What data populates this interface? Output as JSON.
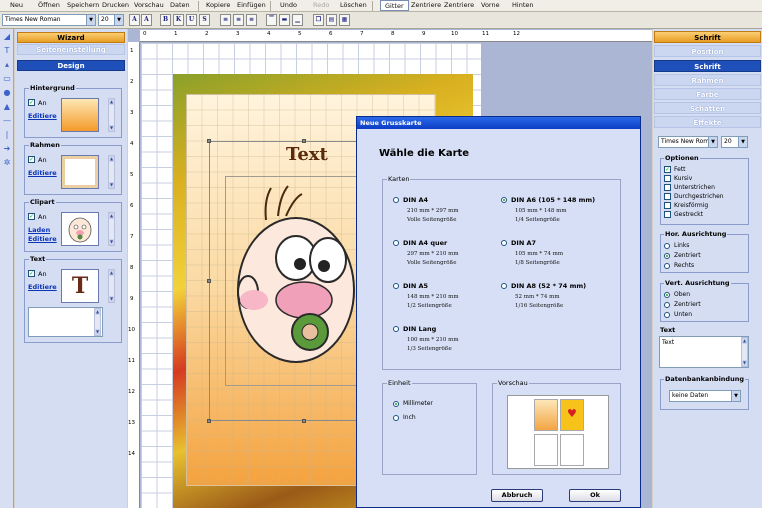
{
  "menu": {
    "items": [
      "Neu",
      "Öffnen",
      "Speichern",
      "Drucken",
      "Vorschau",
      "Daten",
      "Kopiere",
      "Einfügen",
      "Undo",
      "Redo",
      "Löschen",
      "Gitter",
      "Zentriere",
      "Zentriere",
      "Vorne",
      "Hinten"
    ]
  },
  "toolbar": {
    "font_value": "Times New Roman",
    "size_value": "20"
  },
  "left_panel": {
    "tab_wizard": "Wizard",
    "tab_page_setup": "Seiteneinstellung",
    "tab_design": "Design",
    "background": {
      "title": "Hintergrund",
      "on_label": "An",
      "edit_link": "Editiere"
    },
    "frame": {
      "title": "Rahmen",
      "on_label": "An",
      "edit_link": "Editiere"
    },
    "clipart": {
      "title": "Clipart",
      "on_label": "An",
      "load_link": "Laden",
      "edit_link": "Editiere"
    },
    "text": {
      "title": "Text",
      "on_label": "An",
      "edit_link": "Editiere"
    }
  },
  "rulers": {
    "top": [
      "0",
      "1",
      "2",
      "3",
      "4",
      "5",
      "6",
      "7",
      "8",
      "9",
      "10",
      "11",
      "12"
    ],
    "left": [
      "1",
      "2",
      "3",
      "4",
      "5",
      "6",
      "7",
      "8",
      "9",
      "10",
      "11",
      "12",
      "13",
      "14"
    ]
  },
  "canvas": {
    "card_text": "Text"
  },
  "right_panel": {
    "tabs": [
      "Schrift",
      "Position",
      "Schrift",
      "Rahmen",
      "Farbe",
      "Schatten",
      "Effekte"
    ],
    "font_value": "Times New Rom",
    "size_value": "20",
    "options": {
      "title": "Optionen",
      "items": [
        {
          "label": "Fett",
          "checked": true
        },
        {
          "label": "Kursiv",
          "checked": false
        },
        {
          "label": "Unterstrichen",
          "checked": false
        },
        {
          "label": "Durchgestrichen",
          "checked": false
        },
        {
          "label": "Kreisförmig",
          "checked": false
        },
        {
          "label": "Gestreckt",
          "checked": false
        }
      ]
    },
    "h_align": {
      "title": "Hor. Ausrichtung",
      "items": [
        {
          "label": "Links",
          "selected": false
        },
        {
          "label": "Zentriert",
          "selected": true
        },
        {
          "label": "Rechts",
          "selected": false
        }
      ]
    },
    "v_align": {
      "title": "Vert. Ausrichtung",
      "items": [
        {
          "label": "Oben",
          "selected": true
        },
        {
          "label": "Zentriert",
          "selected": false
        },
        {
          "label": "Unten",
          "selected": false
        }
      ]
    },
    "text": {
      "title": "Text",
      "value": "Text"
    },
    "db": {
      "title": "Datenbankanbindung",
      "value": "keine Daten"
    }
  },
  "dialog": {
    "title": "Neue Grusskarte",
    "heading": "Wähle die Karte",
    "cards_title": "Karten",
    "cards": [
      {
        "name": "DIN A4",
        "size": "210 mm * 297 mm",
        "note": "Volle Seitengröße",
        "selected": false
      },
      {
        "name": "DIN A6 (105 * 148 mm)",
        "size": "105 mm * 148 mm",
        "note": "1/4 Seitengröße",
        "selected": true
      },
      {
        "name": "DIN A4 quer",
        "size": "297 mm * 210 mm",
        "note": "Volle Seitengröße",
        "selected": false
      },
      {
        "name": "DIN A7",
        "size": "105 mm * 74 mm",
        "note": "1/8 Seitengröße",
        "selected": false
      },
      {
        "name": "DIN A5",
        "size": "148 mm * 210 mm",
        "note": "1/2 Seitengröße",
        "selected": false
      },
      {
        "name": "DIN A8 (52 * 74 mm)",
        "size": "52 mm * 74 mm",
        "note": "1/16 Seitengröße",
        "selected": false
      },
      {
        "name": "DIN Lang",
        "size": "100 mm * 210 mm",
        "note": "1/3 Seitengröße",
        "selected": false
      }
    ],
    "unit_title": "Einheit",
    "units": [
      {
        "label": "Millimeter",
        "selected": true
      },
      {
        "label": "Inch",
        "selected": false
      }
    ],
    "preview_title": "Vorschau",
    "cancel_label": "Abbruch",
    "ok_label": "Ok"
  }
}
